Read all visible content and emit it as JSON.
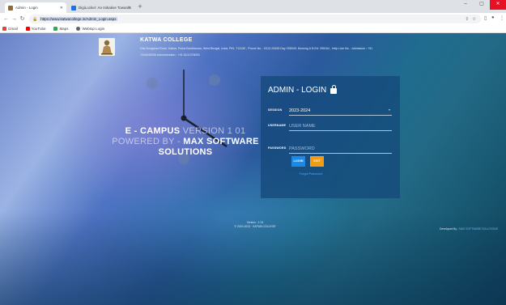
{
  "browser": {
    "tabs": [
      {
        "title": "Admin - Login",
        "active": true,
        "favicon_color": "#8a6d3b"
      },
      {
        "title": "DigiLocker: An Initiative Towards",
        "active": false,
        "favicon_color": "#1a73e8"
      }
    ],
    "url": "https://www.katwacollege.in/Admin_Login.aspx",
    "bookmarks": [
      {
        "label": "Gmail",
        "icon": "gmail-icon",
        "color": "#ea4335"
      },
      {
        "label": "YouTube",
        "icon": "youtube-icon",
        "color": "#ff0000"
      },
      {
        "label": "Maps",
        "icon": "maps-icon",
        "color": "#34a853"
      },
      {
        "label": "Webtop Login",
        "icon": "webtop-icon",
        "color": "#5f6368"
      }
    ]
  },
  "header": {
    "college_name": "KATWA COLLEGE",
    "address_line": "Dak Bungalow Road, Katwa, Purba Bardhaman, West Bengal, India, PIN- 713130 , Phone No. : 0312-25455 Day 255049, Morning & B.Ed: 255164 , Help Line No. : Admission : +91",
    "contact_line": "7044949936 Administration : +91 8101378093"
  },
  "hero": {
    "line1_bold": "E - CAMPUS",
    "line1_light": "VERSION 1 01",
    "line2_light": "POWERED BY -",
    "line2_bold": "MAX SOFTWARE",
    "line3_bold": "SOLUTIONS"
  },
  "login": {
    "title": "ADMIN - LOGIN",
    "session_label": "SESSION",
    "session_value": "2023-2024",
    "username_label": "USERNAME",
    "username_placeholder": "USER NAME",
    "password_label": "PASSWORD",
    "password_placeholder": "PASSWORD",
    "login_button": "LOGIN",
    "exit_button": "EXIT",
    "forgot_link": "Forgot Password"
  },
  "footer": {
    "version": "Version : 1.01",
    "copyright": "© 2019-2023 · KATWA COLLEGE",
    "developed_by_label": "Developed By :",
    "developed_by_link": "MAX SOFTWARE SOLUTIONS"
  },
  "colors": {
    "login_button": "#1e88e5",
    "exit_button": "#f39c12",
    "panel_bg": "#14467a"
  }
}
